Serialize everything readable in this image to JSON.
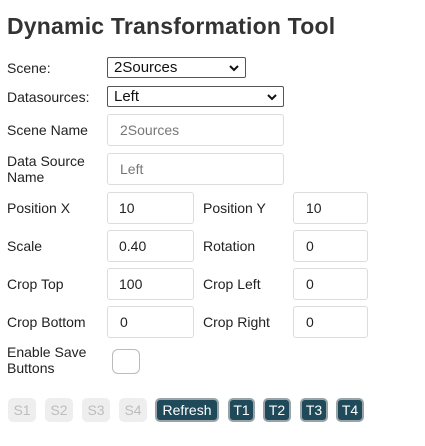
{
  "title": "Dynamic Transformation Tool",
  "scene": {
    "label": "Scene:",
    "value": "2Sources"
  },
  "datasources": {
    "label": "Datasources:",
    "value": "Left"
  },
  "fields": {
    "scene_name": {
      "label": "Scene Name",
      "value": "2Sources"
    },
    "data_source_name": {
      "label_line1": "Data Source",
      "label_line2": "Name",
      "value": "Left"
    },
    "position_x": {
      "label": "Position X",
      "value": "10"
    },
    "position_y": {
      "label": "Position Y",
      "value": "10"
    },
    "scale": {
      "label": "Scale",
      "value": "0.40"
    },
    "rotation": {
      "label": "Rotation",
      "value": "0"
    },
    "crop_top": {
      "label": "Crop Top",
      "value": "100"
    },
    "crop_left": {
      "label": "Crop Left",
      "value": "0"
    },
    "crop_bottom": {
      "label": "Crop Bottom",
      "value": "0"
    },
    "crop_right": {
      "label": "Crop Right",
      "value": "0"
    }
  },
  "enable_save": {
    "label_line1": "Enable Save",
    "label_line2": "Buttons",
    "checked": false
  },
  "buttons": {
    "s1": "S1",
    "s2": "S2",
    "s3": "S3",
    "s4": "S4",
    "refresh": "Refresh",
    "t1": "T1",
    "t2": "T2",
    "t3": "T3",
    "t4": "T4"
  },
  "colors": {
    "active_button": "#1f4a5a",
    "disabled_button": "#eeeeee"
  }
}
